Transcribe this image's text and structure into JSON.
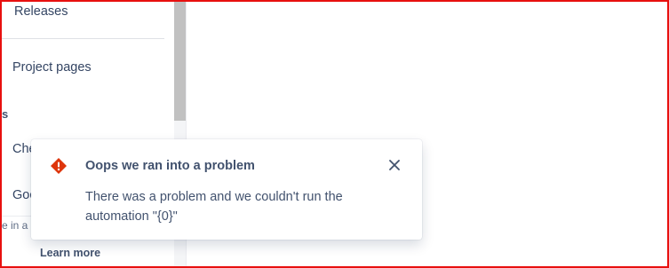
{
  "sidebar": {
    "items": [
      {
        "label": "Releases"
      },
      {
        "label": "Project pages"
      }
    ],
    "section_heading_partial": "s",
    "partial_items": [
      "Che",
      "Goo"
    ],
    "footer_partial_text": "e in a c",
    "learn_more_label": "Learn more"
  },
  "flag": {
    "type": "error",
    "icon": "error-icon",
    "title": "Oops we ran into a problem",
    "body": "There was a problem and we couldn't run the automation \"{0}\"",
    "close_icon": "close-icon",
    "colors": {
      "icon": "#de350b",
      "text": "#42526e"
    }
  },
  "colors": {
    "frame_border": "#e8100f",
    "scroll_thumb": "#c1c1c1"
  }
}
